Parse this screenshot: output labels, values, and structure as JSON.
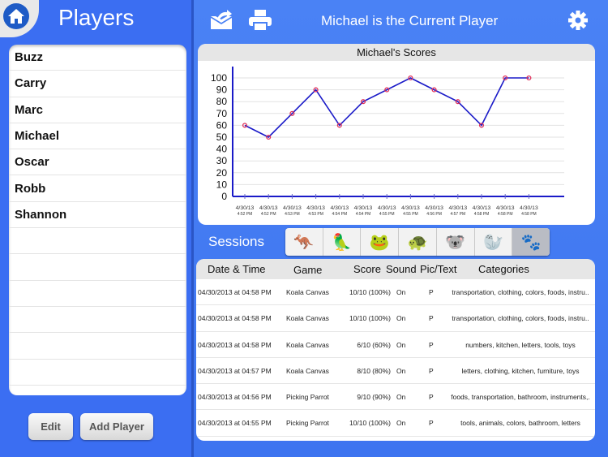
{
  "left": {
    "title": "Players",
    "players": [
      "Buzz",
      "Carry",
      "Marc",
      "Michael",
      "Oscar",
      "Robb",
      "Shannon",
      "",
      "",
      "",
      "",
      "",
      ""
    ],
    "edit_label": "Edit",
    "add_label": "Add Player"
  },
  "toolbar": {
    "current_player_text": "Michael is the Current Player",
    "icons": [
      "mail-forward-icon",
      "printer-icon",
      "gear-icon"
    ]
  },
  "sessions": {
    "label": "Sessions",
    "tabs": [
      {
        "name": "kangaroo",
        "glyph": "🦘"
      },
      {
        "name": "parrot",
        "glyph": "🦜"
      },
      {
        "name": "frog-ball",
        "glyph": "🐸"
      },
      {
        "name": "turtle",
        "glyph": "🐢"
      },
      {
        "name": "koala",
        "glyph": "🐨"
      },
      {
        "name": "seal",
        "glyph": "🦭"
      },
      {
        "name": "all-animals",
        "glyph": "🐾"
      }
    ]
  },
  "table": {
    "headers": [
      "Date & Time",
      "Game",
      "Score",
      "Sound",
      "Pic/Text",
      "Categories"
    ],
    "rows": [
      [
        "04/30/2013 at 04:58 PM",
        "Koala Canvas",
        "10/10 (100%)",
        "On",
        "P",
        "transportation, clothing, colors, foods, instru.."
      ],
      [
        "04/30/2013 at 04:58 PM",
        "Koala Canvas",
        "10/10 (100%)",
        "On",
        "P",
        "transportation, clothing, colors, foods, instru.."
      ],
      [
        "04/30/2013 at 04:58 PM",
        "Koala Canvas",
        "6/10 (60%)",
        "On",
        "P",
        "numbers, kitchen, letters, tools, toys"
      ],
      [
        "04/30/2013 at 04:57 PM",
        "Koala Canvas",
        "8/10 (80%)",
        "On",
        "P",
        "letters, clothing, kitchen, furniture, toys"
      ],
      [
        "04/30/2013 at 04:56 PM",
        "Picking Parrot",
        "9/10 (90%)",
        "On",
        "P",
        "foods, transportation, bathroom, instruments,."
      ],
      [
        "04/30/2013 at 04:55 PM",
        "Picking Parrot",
        "10/10 (100%)",
        "On",
        "P",
        "tools, animals, colors, bathroom, letters"
      ]
    ]
  },
  "chart_data": {
    "type": "line",
    "title": "Michael's Scores",
    "categories": [
      [
        "4/30/13",
        "4:52 PM"
      ],
      [
        "4/30/13",
        "4:52 PM"
      ],
      [
        "4/30/13",
        "4:53 PM"
      ],
      [
        "4/30/13",
        "4:53 PM"
      ],
      [
        "4/30/13",
        "4:54 PM"
      ],
      [
        "4/30/13",
        "4:54 PM"
      ],
      [
        "4/30/13",
        "4:55 PM"
      ],
      [
        "4/30/13",
        "4:55 PM"
      ],
      [
        "4/30/13",
        "4:56 PM"
      ],
      [
        "4/30/13",
        "4:57 PM"
      ],
      [
        "4/30/13",
        "4:58 PM"
      ],
      [
        "4/30/13",
        "4:58 PM"
      ],
      [
        "4/30/13",
        "4:58 PM"
      ]
    ],
    "values": [
      60,
      50,
      70,
      90,
      60,
      80,
      90,
      100,
      90,
      80,
      60,
      100,
      100
    ],
    "yticks": [
      0,
      10,
      20,
      30,
      40,
      50,
      60,
      70,
      80,
      90,
      100
    ],
    "ylim": [
      0,
      100
    ],
    "xlabel": "",
    "ylabel": "",
    "grid": true,
    "line_color": "#1a1ac8",
    "marker_color": "#e0305a"
  }
}
